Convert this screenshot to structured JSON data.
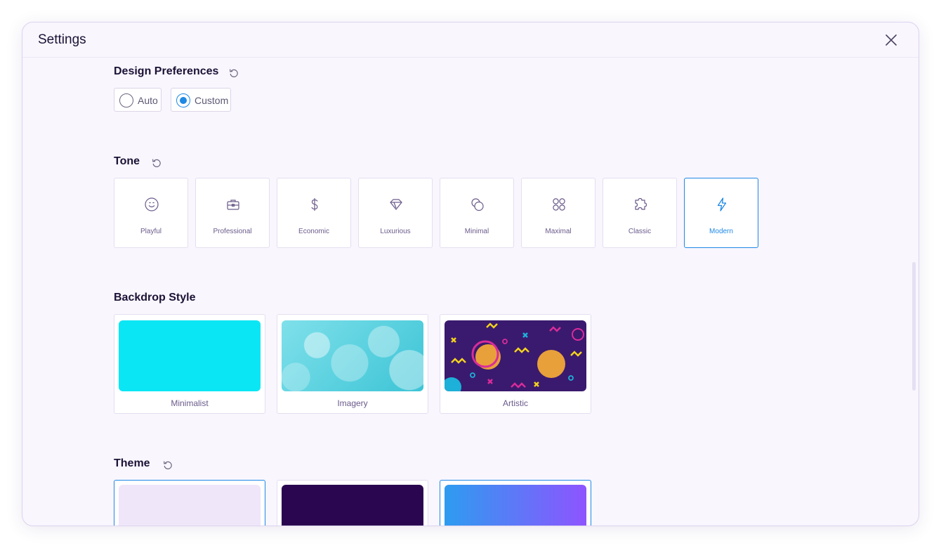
{
  "dialog": {
    "title": "Settings"
  },
  "design_preferences": {
    "title": "Design Preferences",
    "options": [
      {
        "label": "Auto",
        "selected": false
      },
      {
        "label": "Custom",
        "selected": true
      }
    ]
  },
  "tone": {
    "title": "Tone",
    "items": [
      {
        "label": "Playful",
        "icon": "smiley-icon",
        "selected": false
      },
      {
        "label": "Professional",
        "icon": "briefcase-icon",
        "selected": false
      },
      {
        "label": "Economic",
        "icon": "dollar-icon",
        "selected": false
      },
      {
        "label": "Luxurious",
        "icon": "diamond-icon",
        "selected": false
      },
      {
        "label": "Minimal",
        "icon": "circles-overlap-icon",
        "selected": false
      },
      {
        "label": "Maximal",
        "icon": "four-circles-icon",
        "selected": false
      },
      {
        "label": "Classic",
        "icon": "puzzle-icon",
        "selected": false
      },
      {
        "label": "Modern",
        "icon": "lightning-icon",
        "selected": true
      }
    ]
  },
  "backdrop_style": {
    "title": "Backdrop Style",
    "items": [
      {
        "label": "Minimalist",
        "color": "#0be6f4"
      },
      {
        "label": "Imagery",
        "color": "#5fd3e0"
      },
      {
        "label": "Artistic",
        "color": "#3a1a6e"
      }
    ]
  },
  "theme": {
    "title": "Theme",
    "items": [
      {
        "color": "#efe6fa",
        "selected": true
      },
      {
        "color": "#2a0650",
        "selected": false
      },
      {
        "color": "#7d4bff",
        "selected": true
      }
    ]
  },
  "colors": {
    "accent": "#1e88e5",
    "heading": "#1c1235",
    "muted": "#6a5a8a"
  }
}
